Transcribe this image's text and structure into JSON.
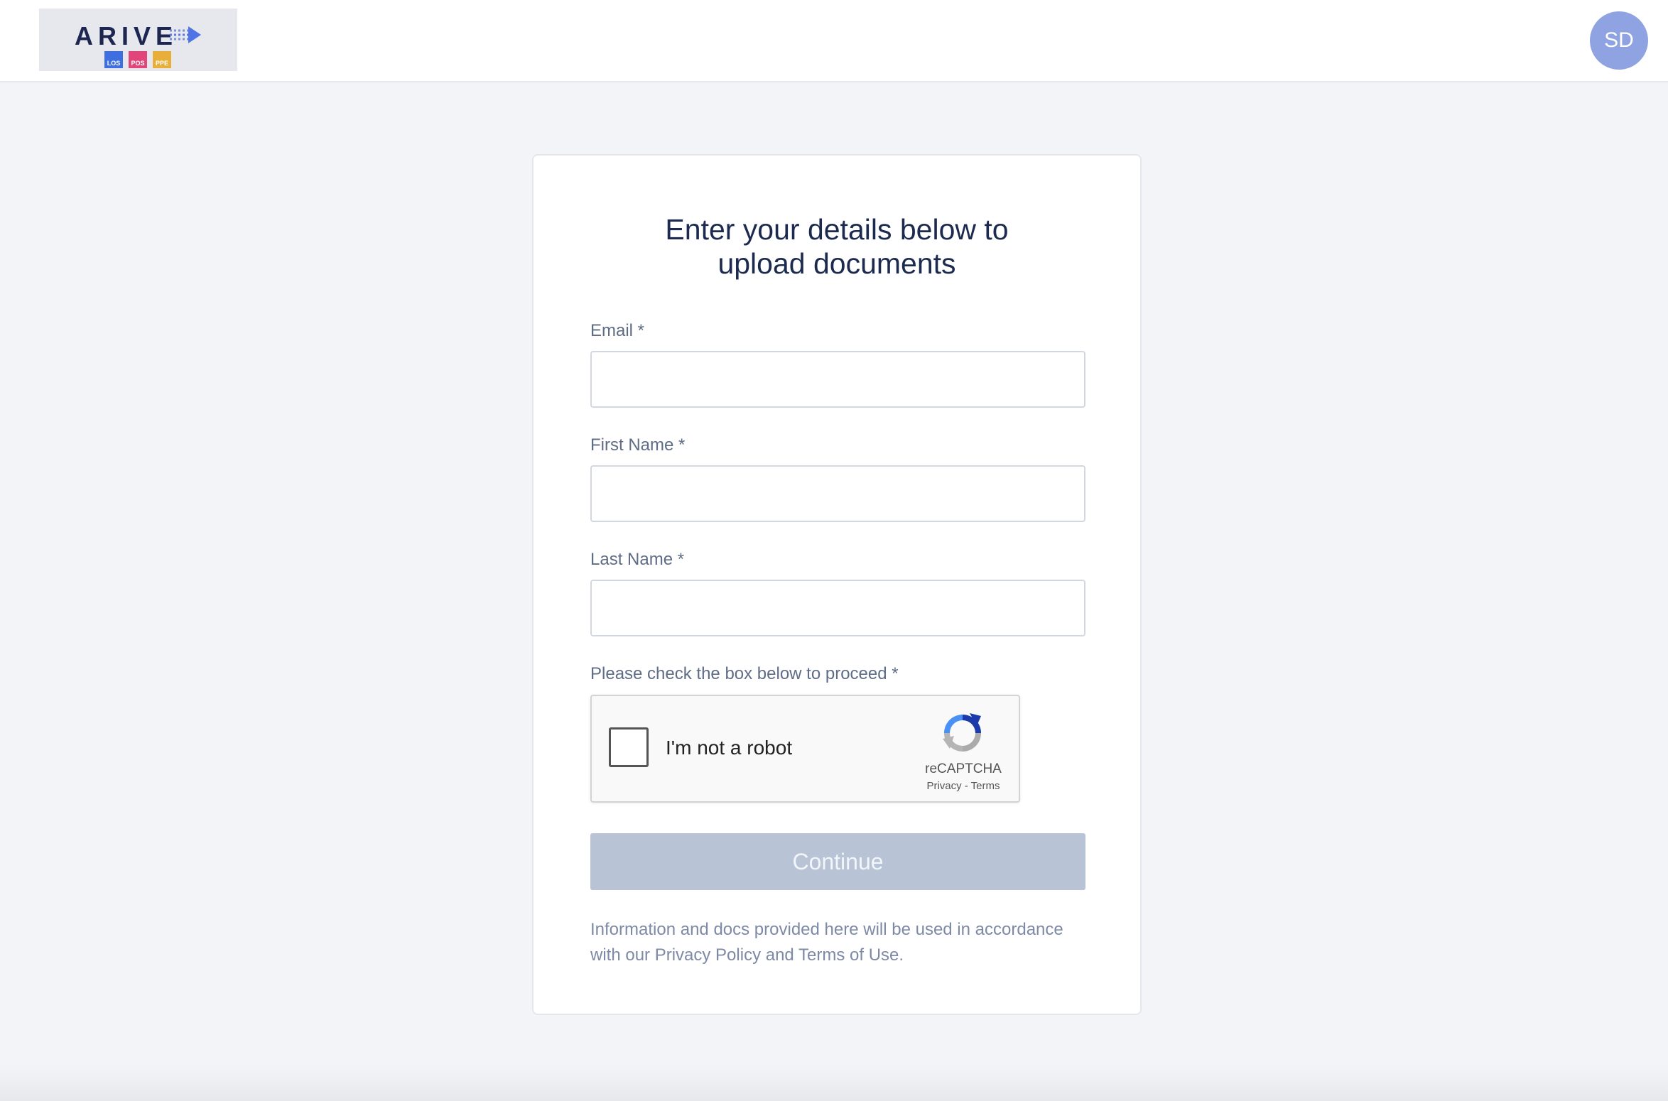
{
  "header": {
    "logo_text": "ARIVE",
    "logo_badges": [
      "LOS",
      "POS",
      "PPE"
    ],
    "avatar_initials": "SD"
  },
  "form": {
    "title": "Enter your details below to upload documents",
    "email_label": "Email *",
    "email_value": "",
    "first_name_label": "First Name *",
    "first_name_value": "",
    "last_name_label": "Last Name *",
    "last_name_value": "",
    "captcha_label": "Please check the box below to proceed *",
    "captcha": {
      "checkbox_text": "I'm not a robot",
      "brand": "reCAPTCHA",
      "links": "Privacy - Terms",
      "checked": false
    },
    "submit_label": "Continue",
    "footer_note": "Information and docs provided here will be used in accordance with our Privacy Policy and Terms of Use."
  },
  "colors": {
    "title": "#1b2a4e",
    "label": "#5f6c86",
    "button_disabled": "#b8c4d6",
    "avatar": "#8fa3e2"
  }
}
